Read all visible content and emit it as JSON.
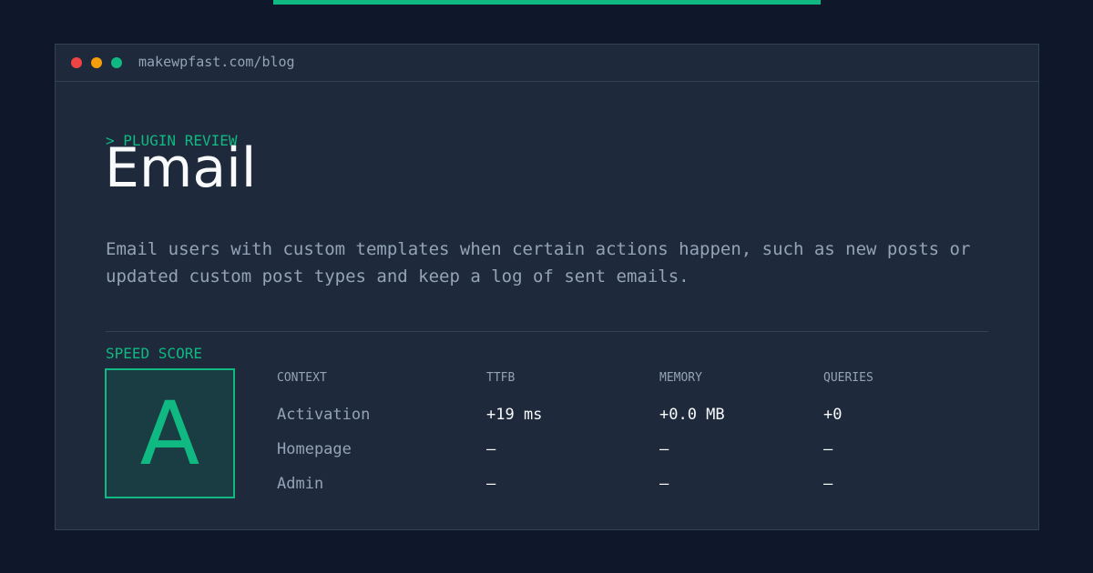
{
  "window": {
    "url": "makewpfast.com/blog",
    "dots": [
      {
        "name": "close",
        "color": "#ef4444"
      },
      {
        "name": "minimize",
        "color": "#f59e0b"
      },
      {
        "name": "maximize",
        "color": "#10b981"
      }
    ]
  },
  "colors": {
    "accent": "#10b981",
    "background": "#0f172a",
    "panel": "#1e293b",
    "text": "#f8fafc",
    "muted": "#94a3b8"
  },
  "header": {
    "eyebrow": "> PLUGIN REVIEW",
    "title": "Email",
    "description": "Email users with custom templates when certain actions happen, such as new posts or updated custom post types and keep a log of sent emails."
  },
  "score": {
    "label": "SPEED SCORE",
    "grade": "A"
  },
  "table": {
    "columns": [
      "CONTEXT",
      "TTFB",
      "MEMORY",
      "QUERIES"
    ],
    "rows": [
      [
        "Activation",
        "+19 ms",
        "+0.0 MB",
        "+0"
      ],
      [
        "Homepage",
        "—",
        "—",
        "—"
      ],
      [
        "Admin",
        "—",
        "—",
        "—"
      ]
    ]
  }
}
